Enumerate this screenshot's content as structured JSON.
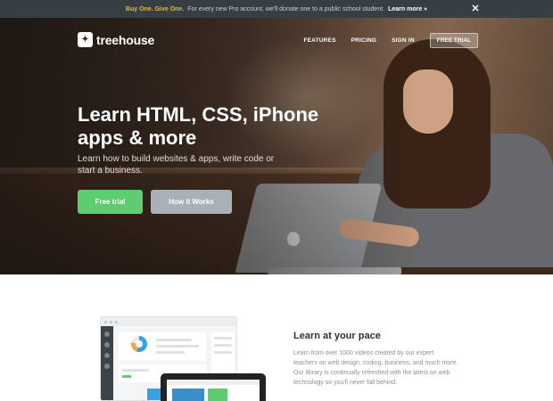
{
  "promo": {
    "highlight": "Buy One. Give One.",
    "text": "For every new Pro account, we'll donate one to a public school student.",
    "link": "Learn more »",
    "close_glyph": "✕"
  },
  "header": {
    "logo_text": "treehouse",
    "logo_icon": "treehouse-leaf-icon",
    "nav": [
      "FEATURES",
      "PRICING",
      "SIGN IN"
    ],
    "cta": "FREE TRIAL"
  },
  "hero": {
    "headline": "Learn HTML, CSS, iPhone apps & more",
    "subline": "Learn how to build websites & apps, write code or start a business.",
    "primary_button": "Free trial",
    "secondary_button": "How it Works"
  },
  "feature": {
    "title": "Learn at your pace",
    "text": "Learn from over 1000 videos created by our expert teachers on web design, coding, business, and much more. Our library is continually refreshed with the latest on web technology so you'll never fall behind."
  },
  "colors": {
    "promo_bg": "#383f44",
    "promo_highlight": "#e6b93b",
    "primary_green": "#5ecc71",
    "secondary_gray": "#aab0b7"
  }
}
